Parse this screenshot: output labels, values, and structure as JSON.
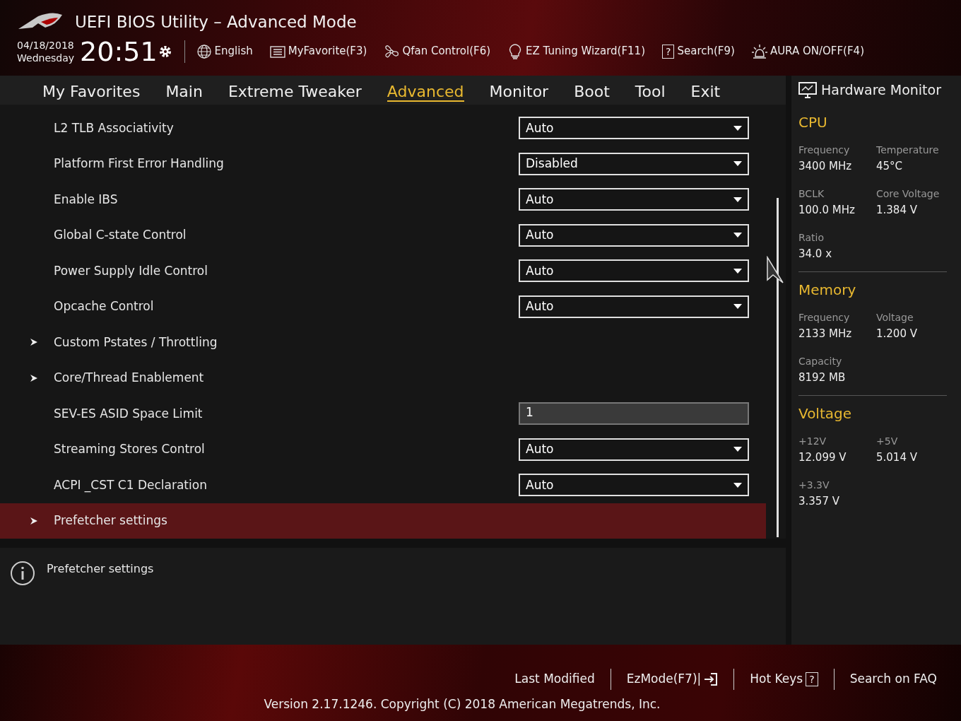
{
  "header": {
    "title": "UEFI BIOS Utility – Advanced Mode",
    "date": "04/18/2018",
    "weekday": "Wednesday",
    "time": "20:51",
    "tools": [
      {
        "label": "English",
        "kind": "globe"
      },
      {
        "label": "MyFavorite(F3)",
        "kind": "list"
      },
      {
        "label": "Qfan Control(F6)",
        "kind": "fan"
      },
      {
        "label": "EZ Tuning Wizard(F11)",
        "kind": "bulb"
      },
      {
        "label": "Search(F9)",
        "kind": "key",
        "key": "?"
      },
      {
        "label": "AURA ON/OFF(F4)",
        "kind": "light"
      }
    ]
  },
  "tabs": [
    {
      "label": "My Favorites",
      "selected": false
    },
    {
      "label": "Main",
      "selected": false
    },
    {
      "label": "Extreme Tweaker",
      "selected": false
    },
    {
      "label": "Advanced",
      "selected": true
    },
    {
      "label": "Monitor",
      "selected": false
    },
    {
      "label": "Boot",
      "selected": false
    },
    {
      "label": "Tool",
      "selected": false
    },
    {
      "label": "Exit",
      "selected": false
    }
  ],
  "settings": [
    {
      "label": "L2 TLB Associativity",
      "kind": "dropdown",
      "value": "Auto",
      "selected": false
    },
    {
      "label": "Platform First Error Handling",
      "kind": "dropdown",
      "value": "Disabled",
      "selected": false
    },
    {
      "label": "Enable IBS",
      "kind": "dropdown",
      "value": "Auto",
      "selected": false
    },
    {
      "label": "Global C-state Control",
      "kind": "dropdown",
      "value": "Auto",
      "selected": false
    },
    {
      "label": "Power Supply Idle Control",
      "kind": "dropdown",
      "value": "Auto",
      "selected": false
    },
    {
      "label": "Opcache Control",
      "kind": "dropdown",
      "value": "Auto",
      "selected": false
    },
    {
      "label": "Custom Pstates / Throttling",
      "kind": "submenu",
      "selected": false
    },
    {
      "label": "Core/Thread Enablement",
      "kind": "submenu",
      "selected": false
    },
    {
      "label": "SEV-ES ASID Space Limit",
      "kind": "number",
      "value": "1",
      "selected": false
    },
    {
      "label": "Streaming Stores Control",
      "kind": "dropdown",
      "value": "Auto",
      "selected": false
    },
    {
      "label": "ACPI _CST C1 Declaration",
      "kind": "dropdown",
      "value": "Auto",
      "selected": false
    },
    {
      "label": "Prefetcher settings",
      "kind": "submenu",
      "selected": true
    }
  ],
  "help": {
    "text": "Prefetcher settings"
  },
  "hardware_monitor": {
    "title": "Hardware Monitor",
    "sections": [
      {
        "title": "CPU",
        "items": [
          {
            "label": "Frequency",
            "value": "3400 MHz"
          },
          {
            "label": "Temperature",
            "value": "45°C"
          },
          {
            "label": "BCLK",
            "value": "100.0 MHz"
          },
          {
            "label": "Core Voltage",
            "value": "1.384 V"
          },
          {
            "label": "Ratio",
            "value": "34.0 x"
          }
        ]
      },
      {
        "title": "Memory",
        "items": [
          {
            "label": "Frequency",
            "value": "2133 MHz"
          },
          {
            "label": "Voltage",
            "value": "1.200 V"
          },
          {
            "label": "Capacity",
            "value": "8192 MB"
          }
        ]
      },
      {
        "title": "Voltage",
        "items": [
          {
            "label": "+12V",
            "value": "12.099 V"
          },
          {
            "label": "+5V",
            "value": "5.014 V"
          },
          {
            "label": "+3.3V",
            "value": "3.357 V"
          }
        ]
      }
    ]
  },
  "footer": {
    "links": [
      {
        "label": "Last Modified",
        "kind": "plain"
      },
      {
        "label": "EzMode(F7)|",
        "kind": "exit"
      },
      {
        "label": "Hot Keys",
        "kind": "key",
        "key": "?"
      },
      {
        "label": "Search on FAQ",
        "kind": "plain"
      }
    ],
    "version": "Version 2.17.1246. Copyright (C) 2018 American Megatrends, Inc."
  }
}
